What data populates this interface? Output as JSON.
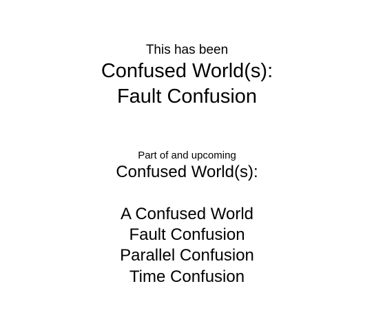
{
  "intro": {
    "preface": "This has been",
    "title_line1": "Confused World(s):",
    "title_line2": "Fault Confusion"
  },
  "series": {
    "preface": "Part of and upcoming",
    "title": "Confused World(s):",
    "items": [
      "A Confused World",
      "Fault Confusion",
      "Parallel Confusion",
      "Time Confusion"
    ]
  },
  "colors": {
    "background": "#ffffff",
    "text": "#000000"
  }
}
